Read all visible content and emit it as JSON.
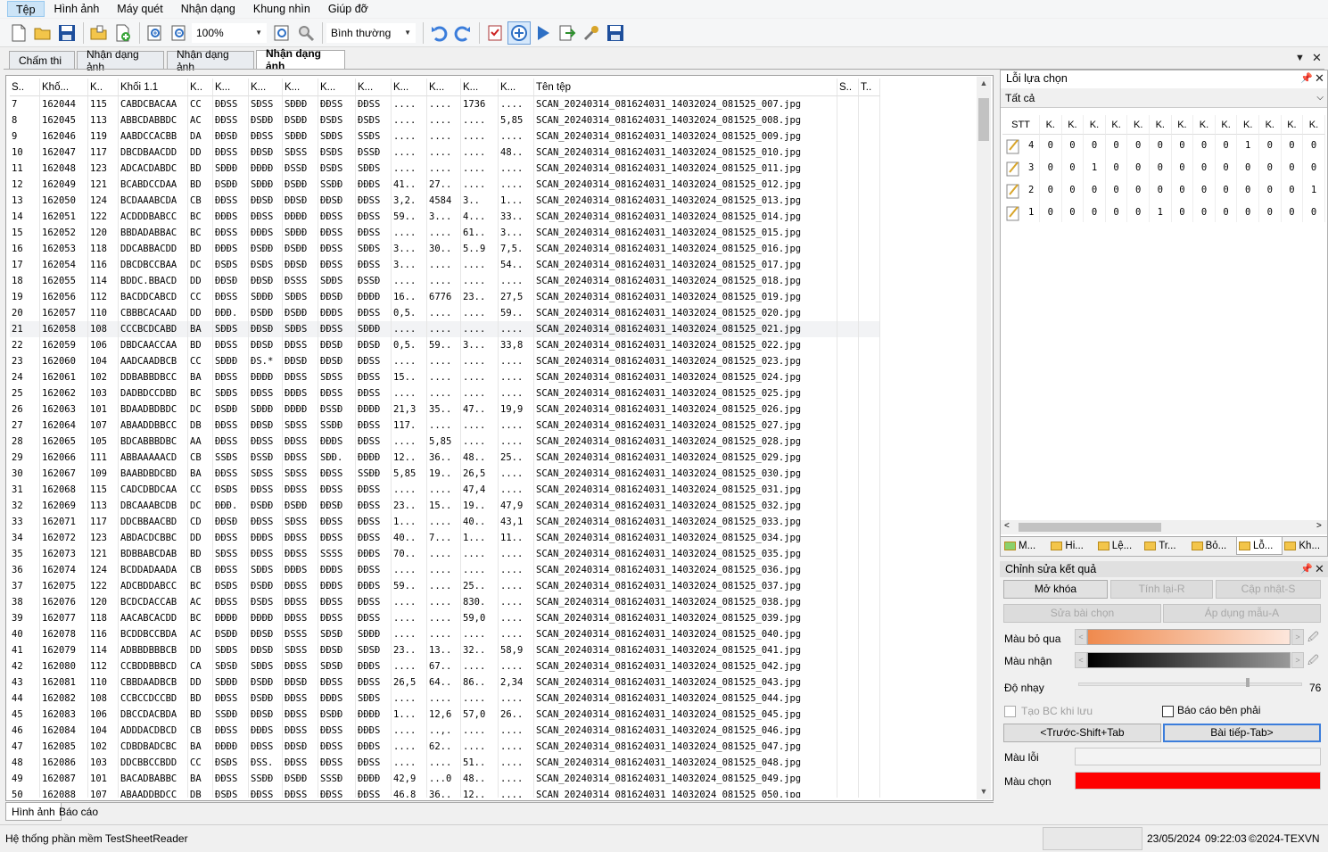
{
  "menu": [
    "Tệp",
    "Hình ảnh",
    "Máy quét",
    "Nhận dạng",
    "Khung nhìn",
    "Giúp đỡ"
  ],
  "toolbar": {
    "zoom": "100%",
    "mode": "Bình thường",
    "icons": [
      "new-file-icon",
      "open-folder-icon",
      "save-icon",
      "open-batch-icon",
      "add-page-icon",
      "zoom-in-icon",
      "zoom-out-icon",
      "fit-page-icon",
      "magnifier-icon",
      "undo-icon",
      "redo-icon",
      "check-list-icon",
      "scanner-icon",
      "run-icon",
      "export-icon",
      "tools-icon",
      "save-all-icon"
    ]
  },
  "doc_tabs": [
    "Chấm thi",
    "Nhận dạng ảnh",
    "Nhận dạng ảnh",
    "Nhận dạng ảnh"
  ],
  "grid": {
    "headers": [
      "S..",
      "Khố...",
      "K..",
      "Khối 1.1",
      "K..",
      "K...",
      "K...",
      "K...",
      "K...",
      "K...",
      "K...",
      "K...",
      "K...",
      "K...",
      "Tên tệp",
      "S..",
      "T.."
    ],
    "rows": [
      [
        "7",
        "162044",
        "115",
        "CABDCBACAA",
        "CC",
        "ĐĐSS",
        "SĐSS",
        "SĐĐĐ",
        "ĐĐSS",
        "ĐĐSS",
        "....",
        "....",
        "1736",
        "....",
        "SCAN_20240314_081624031_14032024_081525_007.jpg"
      ],
      [
        "8",
        "162045",
        "113",
        "ABBCDABBDC",
        "AC",
        "ĐĐSS",
        "ĐSĐĐ",
        "ĐSĐĐ",
        "ĐSĐS",
        "ĐSĐS",
        "....",
        "....",
        "....",
        "5,85",
        "SCAN_20240314_081624031_14032024_081525_008.jpg"
      ],
      [
        "9",
        "162046",
        "119",
        "AABDCCACBB",
        "DA",
        "ĐĐSĐ",
        "ĐĐSS",
        "SĐĐĐ",
        "SĐĐS",
        "SSĐS",
        "....",
        "....",
        "....",
        "....",
        "SCAN_20240314_081624031_14032024_081525_009.jpg"
      ],
      [
        "10",
        "162047",
        "117",
        "DBCDBAACDD",
        "DD",
        "ĐĐSS",
        "ĐĐSĐ",
        "SĐSS",
        "ĐSĐS",
        "ĐSSĐ",
        "....",
        "....",
        "....",
        "48..",
        "SCAN_20240314_081624031_14032024_081525_010.jpg"
      ],
      [
        "11",
        "162048",
        "123",
        "ADCACDABDC",
        "BD",
        "SĐĐĐ",
        "ĐĐĐĐ",
        "ĐSSĐ",
        "ĐSĐS",
        "SĐĐS",
        "....",
        "....",
        "....",
        "....",
        "SCAN_20240314_081624031_14032024_081525_011.jpg"
      ],
      [
        "12",
        "162049",
        "121",
        "BCABDCCDAA",
        "BD",
        "ĐSĐĐ",
        "SĐĐĐ",
        "ĐSĐĐ",
        "SSĐĐ",
        "ĐĐĐS",
        "41..",
        "27..",
        "....",
        "....",
        "SCAN_20240314_081624031_14032024_081525_012.jpg"
      ],
      [
        "13",
        "162050",
        "124",
        "BCDAAABCDA",
        "CB",
        "ĐĐSS",
        "ĐĐSĐ",
        "ĐĐSĐ",
        "ĐĐSĐ",
        "ĐĐSS",
        "3,2.",
        "4584",
        "3..",
        "1...",
        "SCAN_20240314_081624031_14032024_081525_013.jpg"
      ],
      [
        "14",
        "162051",
        "122",
        "ACDDDBABCC",
        "BC",
        "ĐĐĐS",
        "ĐĐSS",
        "ĐĐĐĐ",
        "ĐĐSS",
        "ĐĐSS",
        "59..",
        "3...",
        "4...",
        "33..",
        "SCAN_20240314_081624031_14032024_081525_014.jpg"
      ],
      [
        "15",
        "162052",
        "120",
        "BBDADABBAC",
        "BC",
        "ĐĐSS",
        "ĐĐĐS",
        "SĐĐĐ",
        "ĐĐSS",
        "ĐĐSS",
        "....",
        "....",
        "61..",
        "3...",
        "SCAN_20240314_081624031_14032024_081525_015.jpg"
      ],
      [
        "16",
        "162053",
        "118",
        "DDCABBACDD",
        "BD",
        "ĐĐĐS",
        "ĐSĐĐ",
        "ĐSĐĐ",
        "ĐĐSS",
        "SĐĐS",
        "3...",
        "30..",
        "5..9",
        "7,5.",
        "SCAN_20240314_081624031_14032024_081525_016.jpg"
      ],
      [
        "17",
        "162054",
        "116",
        "DBCDBCCBAA",
        "DC",
        "ĐSĐS",
        "ĐSĐS",
        "ĐĐSĐ",
        "ĐĐSS",
        "ĐĐSS",
        "3...",
        "....",
        "....",
        "54..",
        "SCAN_20240314_081624031_14032024_081525_017.jpg"
      ],
      [
        "18",
        "162055",
        "114",
        "BDDC.BBACD",
        "DD",
        "ĐĐSĐ",
        "ĐĐSĐ",
        "ĐSSS",
        "SĐĐS",
        "ĐSSĐ",
        "....",
        "....",
        "....",
        "....",
        "SCAN_20240314_081624031_14032024_081525_018.jpg"
      ],
      [
        "19",
        "162056",
        "112",
        "BACDDCABCD",
        "CC",
        "ĐĐSS",
        "SĐĐĐ",
        "SĐĐS",
        "ĐĐSĐ",
        "ĐĐĐĐ",
        "16..",
        "6776",
        "23..",
        "27,5",
        "SCAN_20240314_081624031_14032024_081525_019.jpg"
      ],
      [
        "20",
        "162057",
        "110",
        "CBBBCACAAD",
        "DD",
        "ĐĐĐ.",
        "ĐSĐĐ",
        "ĐSĐĐ",
        "ĐĐĐS",
        "ĐĐSS",
        "0,5.",
        "....",
        "....",
        "59..",
        "SCAN_20240314_081624031_14032024_081525_020.jpg"
      ],
      [
        "21",
        "162058",
        "108",
        "CCCBCDCABD",
        "BA",
        "SĐĐS",
        "ĐĐSĐ",
        "SĐĐS",
        "ĐĐSS",
        "SĐĐĐ",
        "....",
        "....",
        "....",
        "....",
        "SCAN_20240314_081624031_14032024_081525_021.jpg"
      ],
      [
        "22",
        "162059",
        "106",
        "DBDCAACCAA",
        "BD",
        "ĐĐSS",
        "ĐĐSĐ",
        "ĐĐSS",
        "ĐĐSĐ",
        "ĐĐSĐ",
        "0,5.",
        "59..",
        "3...",
        "33,8",
        "SCAN_20240314_081624031_14032024_081525_022.jpg"
      ],
      [
        "23",
        "162060",
        "104",
        "AADCAADBCB",
        "CC",
        "SĐĐĐ",
        "ĐS.*",
        "ĐĐSĐ",
        "ĐĐSĐ",
        "ĐĐSS",
        "....",
        "....",
        "....",
        "....",
        "SCAN_20240314_081624031_14032024_081525_023.jpg"
      ],
      [
        "24",
        "162061",
        "102",
        "DDBABBDBCC",
        "BA",
        "ĐĐSS",
        "ĐĐĐĐ",
        "ĐĐSS",
        "SĐSS",
        "ĐĐSS",
        "15..",
        "....",
        "....",
        "....",
        "SCAN_20240314_081624031_14032024_081525_024.jpg"
      ],
      [
        "25",
        "162062",
        "103",
        "DADBDCCDBD",
        "BC",
        "SĐĐS",
        "ĐĐSS",
        "ĐĐĐS",
        "ĐĐSS",
        "ĐĐSS",
        "....",
        "....",
        "....",
        "....",
        "SCAN_20240314_081624031_14032024_081525_025.jpg"
      ],
      [
        "26",
        "162063",
        "101",
        "BDAADBDBDC",
        "DC",
        "ĐSĐĐ",
        "SĐĐĐ",
        "ĐĐĐĐ",
        "ĐSSĐ",
        "ĐĐĐĐ",
        "21,3",
        "35..",
        "47..",
        "19,9",
        "SCAN_20240314_081624031_14032024_081525_026.jpg"
      ],
      [
        "27",
        "162064",
        "107",
        "ABAADDBBCC",
        "DB",
        "ĐĐSS",
        "ĐĐSĐ",
        "SĐSS",
        "SSĐĐ",
        "ĐĐSS",
        "117.",
        "....",
        "....",
        "....",
        "SCAN_20240314_081624031_14032024_081525_027.jpg"
      ],
      [
        "28",
        "162065",
        "105",
        "BDCABBBDBC",
        "AA",
        "ĐĐSS",
        "ĐĐSS",
        "ĐĐSS",
        "ĐĐĐS",
        "ĐĐSS",
        "....",
        "5,85",
        "....",
        "....",
        "SCAN_20240314_081624031_14032024_081525_028.jpg"
      ],
      [
        "29",
        "162066",
        "111",
        "ABBAAAAACD",
        "CB",
        "SSĐS",
        "ĐSSĐ",
        "ĐĐSS",
        "SĐĐ.",
        "ĐĐĐĐ",
        "12..",
        "36..",
        "48..",
        "25..",
        "SCAN_20240314_081624031_14032024_081525_029.jpg"
      ],
      [
        "30",
        "162067",
        "109",
        "BAABDBDCBD",
        "BA",
        "ĐĐSS",
        "SĐSS",
        "SĐSS",
        "ĐĐSS",
        "SSĐĐ",
        "5,85",
        "19..",
        "26,5",
        "....",
        "SCAN_20240314_081624031_14032024_081525_030.jpg"
      ],
      [
        "31",
        "162068",
        "115",
        "CADCDBDCAA",
        "CC",
        "ĐSĐS",
        "ĐĐSS",
        "ĐĐSS",
        "ĐĐSS",
        "ĐĐSS",
        "....",
        "....",
        "47,4",
        "....",
        "SCAN_20240314_081624031_14032024_081525_031.jpg"
      ],
      [
        "32",
        "162069",
        "113",
        "DBCAAABCDB",
        "DC",
        "ĐĐĐ.",
        "ĐSĐĐ",
        "ĐSĐĐ",
        "ĐĐSĐ",
        "ĐĐSS",
        "23..",
        "15..",
        "19..",
        "47,9",
        "SCAN_20240314_081624031_14032024_081525_032.jpg"
      ],
      [
        "33",
        "162071",
        "117",
        "DDCBBAACBD",
        "CD",
        "ĐĐSĐ",
        "ĐĐSS",
        "SĐSS",
        "ĐĐSS",
        "ĐĐSS",
        "1...",
        "....",
        "40..",
        "43,1",
        "SCAN_20240314_081624031_14032024_081525_033.jpg"
      ],
      [
        "34",
        "162072",
        "123",
        "ABDACDCBBC",
        "DD",
        "ĐĐSS",
        "ĐĐĐS",
        "ĐĐSS",
        "ĐĐSS",
        "ĐĐSS",
        "40..",
        "7...",
        "1...",
        "11..",
        "SCAN_20240314_081624031_14032024_081525_034.jpg"
      ],
      [
        "35",
        "162073",
        "121",
        "BDBBABCDAB",
        "BD",
        "SĐSS",
        "ĐĐSS",
        "ĐĐSS",
        "SSSS",
        "ĐĐĐS",
        "70..",
        "....",
        "....",
        "....",
        "SCAN_20240314_081624031_14032024_081525_035.jpg"
      ],
      [
        "36",
        "162074",
        "124",
        "BCDDADAADA",
        "CB",
        "ĐĐSS",
        "SĐĐS",
        "ĐĐĐS",
        "ĐĐĐS",
        "ĐĐSS",
        "....",
        "....",
        "....",
        "....",
        "SCAN_20240314_081624031_14032024_081525_036.jpg"
      ],
      [
        "37",
        "162075",
        "122",
        "ADCBDDABCC",
        "BC",
        "ĐSĐS",
        "ĐSĐĐ",
        "ĐĐSS",
        "ĐĐĐS",
        "ĐĐĐS",
        "59..",
        "....",
        "25..",
        "....",
        "SCAN_20240314_081624031_14032024_081525_037.jpg"
      ],
      [
        "38",
        "162076",
        "120",
        "BCDCDACCAB",
        "AC",
        "ĐĐSS",
        "ĐSĐS",
        "ĐĐSS",
        "ĐĐSS",
        "ĐĐSS",
        "....",
        "....",
        "830.",
        "....",
        "SCAN_20240314_081624031_14032024_081525_038.jpg"
      ],
      [
        "39",
        "162077",
        "118",
        "AACABCACDD",
        "BC",
        "ĐĐĐĐ",
        "ĐĐĐĐ",
        "ĐĐSS",
        "ĐĐSS",
        "ĐĐSS",
        "....",
        "....",
        "59,0",
        "....",
        "SCAN_20240314_081624031_14032024_081525_039.jpg"
      ],
      [
        "40",
        "162078",
        "116",
        "BCDDBCCBDA",
        "AC",
        "ĐSĐĐ",
        "ĐĐSĐ",
        "ĐSSS",
        "SĐSĐ",
        "SĐĐĐ",
        "....",
        "....",
        "....",
        "....",
        "SCAN_20240314_081624031_14032024_081525_040.jpg"
      ],
      [
        "41",
        "162079",
        "114",
        "ADBBDBBBCB",
        "DD",
        "SĐĐS",
        "ĐĐSĐ",
        "SĐSS",
        "ĐĐSĐ",
        "SĐSĐ",
        "23..",
        "13..",
        "32..",
        "58,9",
        "SCAN_20240314_081624031_14032024_081525_041.jpg"
      ],
      [
        "42",
        "162080",
        "112",
        "CCBDDBBBCD",
        "CA",
        "SĐSĐ",
        "SĐĐS",
        "ĐĐSS",
        "SĐSĐ",
        "ĐĐĐS",
        "....",
        "67..",
        "....",
        "....",
        "SCAN_20240314_081624031_14032024_081525_042.jpg"
      ],
      [
        "43",
        "162081",
        "110",
        "CBBDAADBCB",
        "DD",
        "SĐĐĐ",
        "ĐSĐĐ",
        "ĐĐSĐ",
        "ĐĐSS",
        "ĐĐSS",
        "26,5",
        "64..",
        "86..",
        "2,34",
        "SCAN_20240314_081624031_14032024_081525_043.jpg"
      ],
      [
        "44",
        "162082",
        "108",
        "CCBCCDCCBD",
        "BD",
        "ĐĐSS",
        "ĐSĐĐ",
        "ĐĐSS",
        "ĐĐĐS",
        "SĐĐS",
        "....",
        "....",
        "....",
        "....",
        "SCAN_20240314_081624031_14032024_081525_044.jpg"
      ],
      [
        "45",
        "162083",
        "106",
        "DBCCDACBDA",
        "BD",
        "SSĐĐ",
        "ĐĐSĐ",
        "ĐĐSS",
        "ĐSĐĐ",
        "ĐĐĐĐ",
        "1...",
        "12,6",
        "57,0",
        "26..",
        "SCAN_20240314_081624031_14032024_081525_045.jpg"
      ],
      [
        "46",
        "162084",
        "104",
        "ADDDACDBCD",
        "CB",
        "ĐĐSS",
        "ĐĐĐS",
        "ĐĐSS",
        "ĐĐSS",
        "ĐĐĐS",
        "....",
        "..,.",
        "....",
        "....",
        "SCAN_20240314_081624031_14032024_081525_046.jpg"
      ],
      [
        "47",
        "162085",
        "102",
        "CDBDBADCBC",
        "BA",
        "ĐĐĐĐ",
        "ĐĐSS",
        "ĐĐSĐ",
        "ĐĐSS",
        "ĐĐĐS",
        "....",
        "62..",
        "....",
        "....",
        "SCAN_20240314_081624031_14032024_081525_047.jpg"
      ],
      [
        "48",
        "162086",
        "103",
        "DDCBBCCBDD",
        "CC",
        "ĐSĐS",
        "ĐSS.",
        "ĐĐSS",
        "ĐĐSS",
        "ĐĐSS",
        "....",
        "....",
        "51..",
        "....",
        "SCAN_20240314_081624031_14032024_081525_048.jpg"
      ],
      [
        "49",
        "162087",
        "101",
        "BACADBABBC",
        "BA",
        "ĐĐSS",
        "SSĐĐ",
        "ĐSĐĐ",
        "SSSĐ",
        "ĐĐĐĐ",
        "42,9",
        "...0",
        "48..",
        "....",
        "SCAN_20240314_081624031_14032024_081525_049.jpg"
      ],
      [
        "50",
        "162088",
        "107",
        "ABAADDBDCC",
        "DB",
        "ĐSĐS",
        "ĐĐSS",
        "ĐĐSS",
        "ĐĐSS",
        "ĐĐSS",
        "46,8",
        "36..",
        "12..",
        "....",
        "SCAN_20240314_081624031_14032024_081525_050.jpg"
      ]
    ]
  },
  "bottom_tabs": [
    "Hình ảnh",
    "Báo cáo"
  ],
  "error_panel": {
    "title": "Lỗi lựa chọn",
    "filter": "Tất cả",
    "headers": [
      "STT",
      "K.",
      "K.",
      "K.",
      "K.",
      "K.",
      "K.",
      "K.",
      "K.",
      "K.",
      "K.",
      "K.",
      "K.",
      "K."
    ],
    "rows": [
      [
        "4",
        "0",
        "0",
        "0",
        "0",
        "0",
        "0",
        "0",
        "0",
        "0",
        "1",
        "0",
        "0",
        "0"
      ],
      [
        "3",
        "0",
        "0",
        "1",
        "0",
        "0",
        "0",
        "0",
        "0",
        "0",
        "0",
        "0",
        "0",
        "0"
      ],
      [
        "2",
        "0",
        "0",
        "0",
        "0",
        "0",
        "0",
        "0",
        "0",
        "0",
        "0",
        "0",
        "0",
        "1"
      ],
      [
        "1",
        "0",
        "0",
        "0",
        "0",
        "0",
        "1",
        "0",
        "0",
        "0",
        "0",
        "0",
        "0",
        "0"
      ]
    ],
    "tabs": [
      "M...",
      "Hi...",
      "Lệ...",
      "Tr...",
      "Bỏ...",
      "Lỗ...",
      "Kh..."
    ]
  },
  "edit_panel": {
    "title": "Chỉnh sửa kết quả",
    "unlock": "Mở khóa",
    "recalc": "Tính lại-R",
    "update": "Cập nhật-S",
    "edit_selected": "Sửa bài chọn",
    "apply_template": "Áp dụng mẫu-A",
    "skip_color_label": "Màu bỏ qua",
    "recognize_color_label": "Màu nhận",
    "sensitivity_label": "Độ nhạy",
    "sensitivity_value": "76",
    "sensitivity": 0.76,
    "create_report_label": "Tạo BC khi lưu",
    "right_report_label": "Báo cáo bên phải",
    "prev_button": "<Trước-Shift+Tab",
    "next_button": "Bài tiếp-Tab>",
    "error_color_label": "Màu lỗi",
    "selected_color_label": "Màu chọn",
    "selected_color": "#ff0000"
  },
  "status": {
    "left": "Hệ thống phần mềm TestSheetReader",
    "date": "23/05/2024",
    "time": "09:22:03",
    "copyright": "©2024-TEXVN"
  }
}
